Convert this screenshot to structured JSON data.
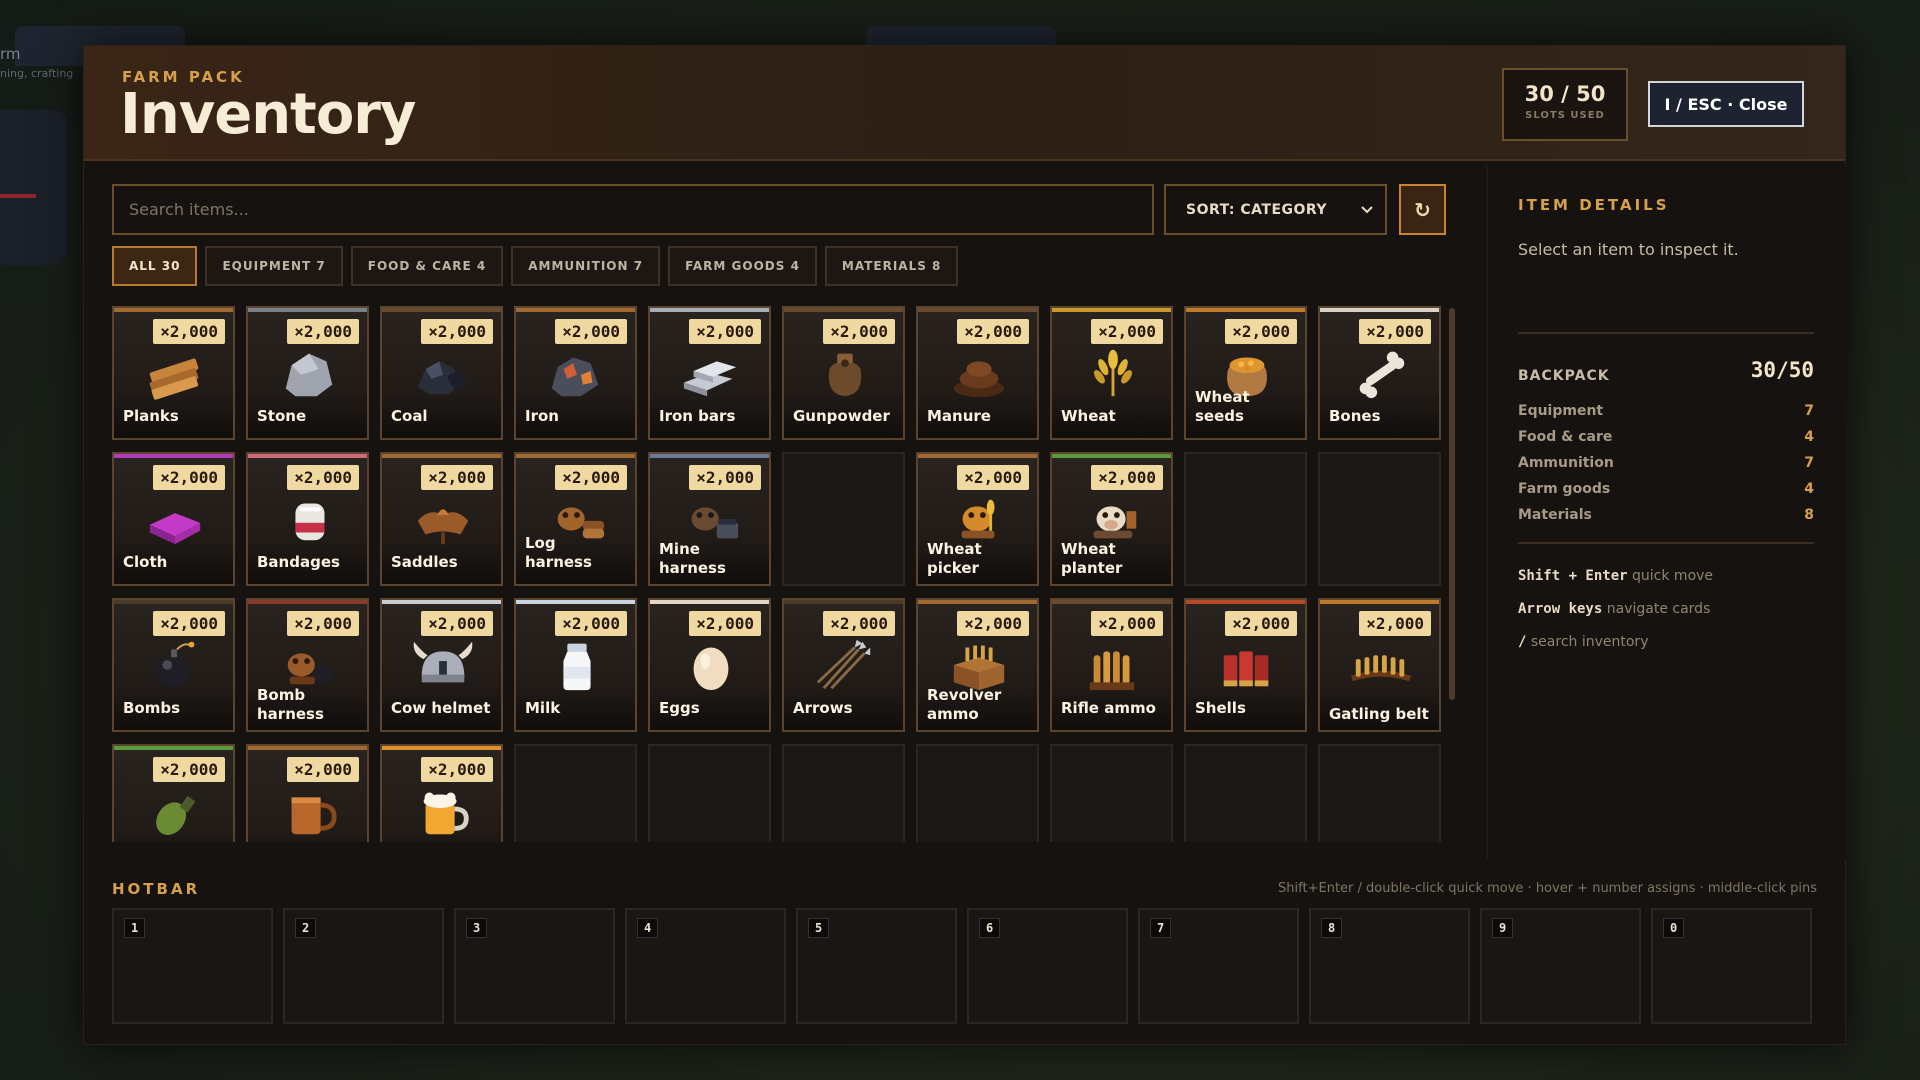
{
  "background": {
    "left_text": "rm",
    "left_sub": "ning, crafting"
  },
  "header": {
    "eyebrow": "FARM PACK",
    "title": "Inventory",
    "slots_value": "30 / 50",
    "slots_label": "SLOTS USED",
    "close_label": "I / ESC · Close"
  },
  "search": {
    "placeholder": "Search items..."
  },
  "sort": {
    "label": "SORT: CATEGORY",
    "icon": "chevron-down-icon"
  },
  "refresh": {
    "icon": "refresh-icon",
    "glyph": "↻"
  },
  "tabs": [
    {
      "label": "ALL 30",
      "active": true
    },
    {
      "label": "EQUIPMENT 7",
      "active": false
    },
    {
      "label": "FOOD & CARE 4",
      "active": false
    },
    {
      "label": "AMMUNITION 7",
      "active": false
    },
    {
      "label": "FARM GOODS 4",
      "active": false
    },
    {
      "label": "MATERIALS 8",
      "active": false
    }
  ],
  "items": [
    {
      "name": "Planks",
      "qty": "×2,000",
      "icon": "planks-icon",
      "accent": "#a0692f"
    },
    {
      "name": "Stone",
      "qty": "×2,000",
      "icon": "stone-icon",
      "accent": "#7a7f8a"
    },
    {
      "name": "Coal",
      "qty": "×2,000",
      "icon": "coal-icon",
      "accent": "#6a4a30"
    },
    {
      "name": "Iron",
      "qty": "×2,000",
      "icon": "iron-ore-icon",
      "accent": "#a0692f"
    },
    {
      "name": "Iron bars",
      "qty": "×2,000",
      "icon": "iron-bars-icon",
      "accent": "#a8adb8"
    },
    {
      "name": "Gunpowder",
      "qty": "×2,000",
      "icon": "gunpowder-sack-icon",
      "accent": "#6a4a30"
    },
    {
      "name": "Manure",
      "qty": "×2,000",
      "icon": "manure-icon",
      "accent": "#6a4a30"
    },
    {
      "name": "Wheat",
      "qty": "×2,000",
      "icon": "wheat-icon",
      "accent": "#c89b2a"
    },
    {
      "name": "Wheat seeds",
      "qty": "×2,000",
      "icon": "seed-sack-icon",
      "accent": "#c07a2a"
    },
    {
      "name": "Bones",
      "qty": "×2,000",
      "icon": "bone-icon",
      "accent": "#d8d4ca"
    },
    {
      "name": "Cloth",
      "qty": "×2,000",
      "icon": "cloth-icon",
      "accent": "#b23ab8"
    },
    {
      "name": "Bandages",
      "qty": "×2,000",
      "icon": "bandage-icon",
      "accent": "#d06a7a"
    },
    {
      "name": "Saddles",
      "qty": "×2,000",
      "icon": "saddle-icon",
      "accent": "#a0692f"
    },
    {
      "name": "Log harness",
      "qty": "×2,000",
      "icon": "log-harness-icon",
      "accent": "#a0692f"
    },
    {
      "name": "Mine harness",
      "qty": "×2,000",
      "icon": "mine-harness-icon",
      "accent": "#6a7a9a"
    },
    null,
    {
      "name": "Wheat picker",
      "qty": "×2,000",
      "icon": "wheat-picker-icon",
      "accent": "#a0692f"
    },
    {
      "name": "Wheat planter",
      "qty": "×2,000",
      "icon": "wheat-planter-icon",
      "accent": "#5a9a3a"
    },
    null,
    null,
    {
      "name": "Bombs",
      "qty": "×2,000",
      "icon": "bomb-icon",
      "accent": "#4a3a2a"
    },
    {
      "name": "Bomb harness",
      "qty": "×2,000",
      "icon": "bomb-harness-icon",
      "accent": "#8a3a2a"
    },
    {
      "name": "Cow helmet",
      "qty": "×2,000",
      "icon": "horned-helmet-icon",
      "accent": "#c8cbd2"
    },
    {
      "name": "Milk",
      "qty": "×2,000",
      "icon": "milk-bottle-icon",
      "accent": "#c8d4e0"
    },
    {
      "name": "Eggs",
      "qty": "×2,000",
      "icon": "egg-icon",
      "accent": "#e0d8c8"
    },
    {
      "name": "Arrows",
      "qty": "×2,000",
      "icon": "arrows-icon",
      "accent": "#4a3a2a"
    },
    {
      "name": "Revolver ammo",
      "qty": "×2,000",
      "icon": "ammo-crate-icon",
      "accent": "#a0692f"
    },
    {
      "name": "Rifle ammo",
      "qty": "×2,000",
      "icon": "rifle-rounds-icon",
      "accent": "#6a4a30"
    },
    {
      "name": "Shells",
      "qty": "×2,000",
      "icon": "shotgun-shells-icon",
      "accent": "#b84a2a"
    },
    {
      "name": "Gatling belt",
      "qty": "×2,000",
      "icon": "ammo-belt-icon",
      "accent": "#c07a2a"
    },
    {
      "name": "",
      "qty": "×2,000",
      "icon": "grenade-icon",
      "accent": "#5a9a3a"
    },
    {
      "name": "",
      "qty": "×2,000",
      "icon": "copper-mug-icon",
      "accent": "#a0692f"
    },
    {
      "name": "",
      "qty": "×2,000",
      "icon": "beer-mug-icon",
      "accent": "#e0902a"
    },
    null,
    null,
    null,
    null,
    null,
    null,
    null
  ],
  "details": {
    "header": "ITEM DETAILS",
    "hint": "Select an item to inspect it.",
    "backpack_label": "BACKPACK",
    "backpack_value": "30/50",
    "categories": [
      {
        "label": "Equipment",
        "value": "7"
      },
      {
        "label": "Food & care",
        "value": "4"
      },
      {
        "label": "Ammunition",
        "value": "7"
      },
      {
        "label": "Farm goods",
        "value": "4"
      },
      {
        "label": "Materials",
        "value": "8"
      }
    ],
    "shortcuts": [
      {
        "key": "Shift + Enter",
        "text": "quick move"
      },
      {
        "key": "Arrow keys",
        "text": "navigate cards"
      },
      {
        "key": "/",
        "text": "search inventory"
      }
    ]
  },
  "hotbar": {
    "header": "HOTBAR",
    "hint": "Shift+Enter / double-click quick move · hover + number assigns · middle-click pins",
    "slots": [
      "1",
      "2",
      "3",
      "4",
      "5",
      "6",
      "7",
      "8",
      "9",
      "0"
    ]
  },
  "colors": {
    "accent": "#d7a04c",
    "panel": "#16120f",
    "badge": "#f0d9a0"
  }
}
